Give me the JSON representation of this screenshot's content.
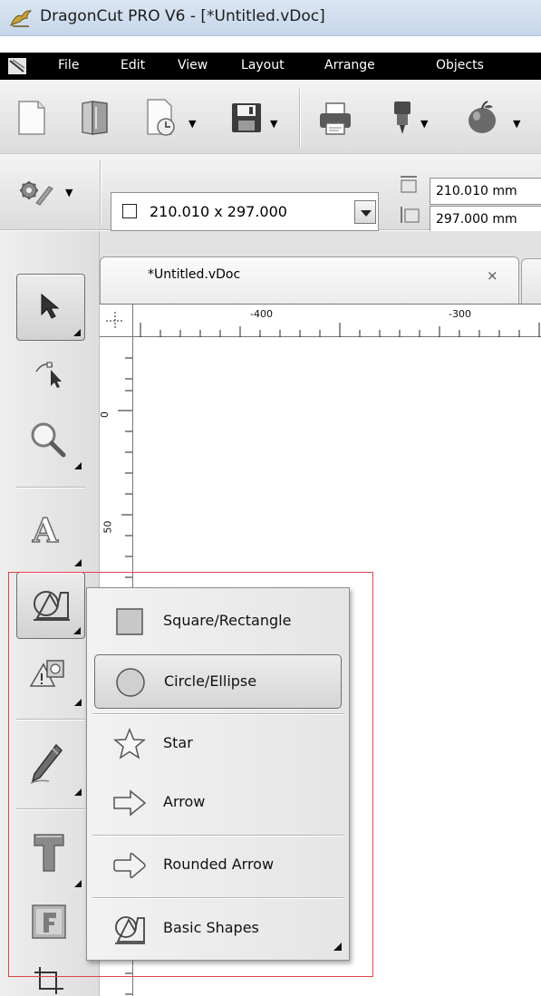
{
  "window": {
    "title": "DragonCut PRO V6 - [*Untitled.vDoc]"
  },
  "menubar": {
    "items": [
      "File",
      "Edit",
      "View",
      "Layout",
      "Arrange",
      "Objects"
    ]
  },
  "toolbar": {
    "buttons": [
      "new-document-icon",
      "open-book-icon",
      "document-clock-icon",
      "save-icon",
      "print-icon",
      "plotter-icon",
      "apple-icon"
    ]
  },
  "property_bar": {
    "settings_icon": "gear-wrench-icon",
    "page_size": "210.010 x 297.000",
    "width_value": "210.010 mm",
    "height_value": "297.000 mm"
  },
  "document_tab": {
    "label": "*Untitled.vDoc",
    "close_glyph": "×"
  },
  "rulers": {
    "horizontal_labels": [
      "-400",
      "-300"
    ],
    "vertical_labels": [
      "0",
      "50"
    ]
  },
  "left_tools": [
    "select-tool",
    "node-edit-tool",
    "zoom-tool",
    "text-tool",
    "shapes-tool",
    "polygon-tool",
    "pencil-tool",
    "t-tool",
    "frame-tool",
    "crop-tool"
  ],
  "shapes_flyout": {
    "items": [
      {
        "label": "Square/Rectangle",
        "icon": "square-icon"
      },
      {
        "label": "Circle/Ellipse",
        "icon": "circle-icon",
        "active": true
      },
      {
        "label": "Star",
        "icon": "star-icon"
      },
      {
        "label": "Arrow",
        "icon": "arrow-icon"
      },
      {
        "label": "Rounded Arrow",
        "icon": "rounded-arrow-icon"
      },
      {
        "label": "Basic Shapes",
        "icon": "basic-shapes-icon"
      }
    ]
  },
  "colors": {
    "highlight": "#e0454a",
    "menubar": "#000000",
    "titlebar": "#c6d6ea"
  }
}
